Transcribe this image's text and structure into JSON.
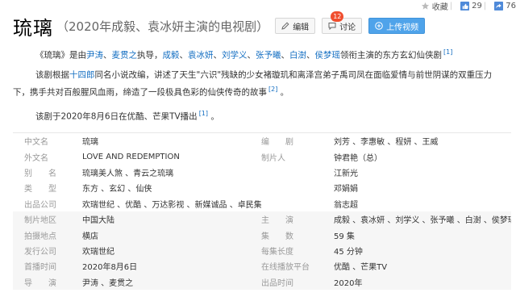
{
  "topbar": {
    "favorite_label": "收藏",
    "like_count": "29",
    "share_count": "76"
  },
  "header": {
    "title": "琉璃",
    "subtitle": "（2020年成毅、袁冰妍主演的电视剧）",
    "edit_label": "编辑",
    "discuss_label": "讨论",
    "discuss_badge": "12",
    "upload_label": "上传视频"
  },
  "paragraphs": {
    "p1": {
      "t1": "《琉璃》是由",
      "l1": "尹涛",
      "t2": "、",
      "l2": "麦贯之",
      "t3": "执导，",
      "l3": "成毅",
      "t4": "、",
      "l4": "袁冰妍",
      "t5": "、",
      "l5": "刘学义",
      "t6": "、",
      "l6": "张予曦",
      "t7": "、",
      "l7": "白澍",
      "t8": "、",
      "l8": "侯梦瑶",
      "t9": "领衔主演的东方玄幻仙侠剧",
      "ref": "[1]"
    },
    "p2": {
      "t1": "该剧根据",
      "l1": "十四郎",
      "t2": "同名小说改编，讲述了天生\"六识\"残缺的少女褚璇玑和离泽宫弟子禹司凤在面临爱情与前世阴谋的双重压力下，携手共对百般腥风血雨，缔造了一段极具色彩的仙侠传奇的故事",
      "ref": "[2]",
      "t3": " 。"
    },
    "p3": {
      "t1": "该剧于2020年8月6日在优酷、芒果TV播出",
      "ref": "[1]",
      "t2": " 。"
    }
  },
  "info_rows": [
    {
      "label": "中文名",
      "value": "琉璃",
      "label2": "编　　剧",
      "value2": "刘芳 、李惠敏 、程妍 、王威"
    },
    {
      "label": "外文名",
      "value": "LOVE AND REDEMPTION",
      "label2": "制片人",
      "value2": "钟君艳（总）"
    },
    {
      "label": "别　　名",
      "value": "琉璃美人煞 、青云之琉璃",
      "label2": "",
      "value2": "江新光"
    },
    {
      "label": "类　　型",
      "value": "东方 、玄幻 、仙侠",
      "label2": "",
      "value2": "邓娟娟"
    },
    {
      "label": "出品公司",
      "value": "欢瑞世纪 、优酷 、万达影视 、新媒诚品 、卓民集嘉",
      "label2": "",
      "value2": "翁志超"
    },
    {
      "label": "制片地区",
      "value": "中国大陆",
      "label2": "主　　演",
      "value2": "成毅 、袁冰妍 、刘学义 、张予曦 、白澍 、侯梦瑶"
    },
    {
      "label": "拍摄地点",
      "value": "横店",
      "label2": "集　　数",
      "value2": "59 集"
    },
    {
      "label": "发行公司",
      "value": "欢瑞世纪",
      "label2": "每集长度",
      "value2": "45 分钟"
    },
    {
      "label": "首播时间",
      "value": "2020年8月6日",
      "label2": "在线播放平台",
      "value2": "优酷 、芒果TV"
    },
    {
      "label": "导　　演",
      "value": "尹涛 、麦贯之",
      "label2": "出品时间",
      "value2": "2020年"
    }
  ]
}
